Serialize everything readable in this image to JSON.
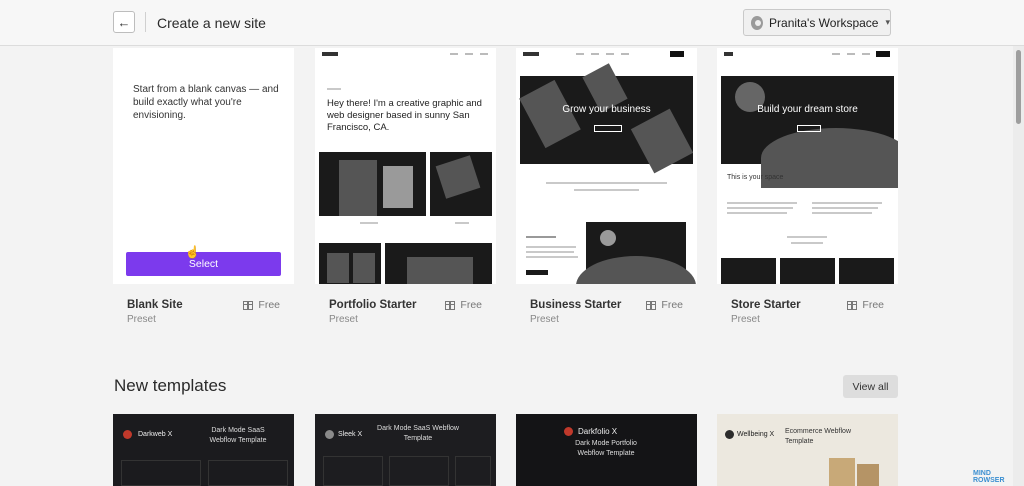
{
  "header": {
    "title": "Create a new site",
    "back_icon": "←",
    "workspace_label": "Pranita's Workspace",
    "workspace_chevron": "▾"
  },
  "presets": [
    {
      "name": "Blank Site",
      "sub": "Preset",
      "price": "Free",
      "description": "Start from a blank canvas — and build exactly what you're envisioning.",
      "select_label": "Select"
    },
    {
      "name": "Portfolio Starter",
      "sub": "Preset",
      "price": "Free",
      "headline": "Hey there! I'm a creative graphic and web designer based in sunny San Francisco, CA."
    },
    {
      "name": "Business Starter",
      "sub": "Preset",
      "price": "Free",
      "hero": "Grow your business"
    },
    {
      "name": "Store Starter",
      "sub": "Preset",
      "price": "Free",
      "hero": "Build your dream store",
      "space": "This is your space"
    }
  ],
  "new_templates": {
    "title": "New templates",
    "view_all": "View all",
    "items": [
      {
        "brand": "Darkweb X",
        "title": "Dark Mode SaaS Webflow Template",
        "bg": "#1b1b1e",
        "accent": "#c0392b"
      },
      {
        "brand": "Sleek X",
        "title": "Dark Mode SaaS Webflow Template",
        "bg": "#1d1d20",
        "accent": "#8a8a8a"
      },
      {
        "brand": "Darkfolio X",
        "title": "Dark Mode Portfolio Webflow Template",
        "bg": "#141416",
        "accent": "#c0392b"
      },
      {
        "brand": "Wellbeing X",
        "title": "Ecommerce Webflow Template",
        "bg": "#ece8df",
        "accent": "#2c2c2c"
      }
    ]
  },
  "watermark": {
    "line1": "MIND",
    "line2": "ROWSER"
  }
}
